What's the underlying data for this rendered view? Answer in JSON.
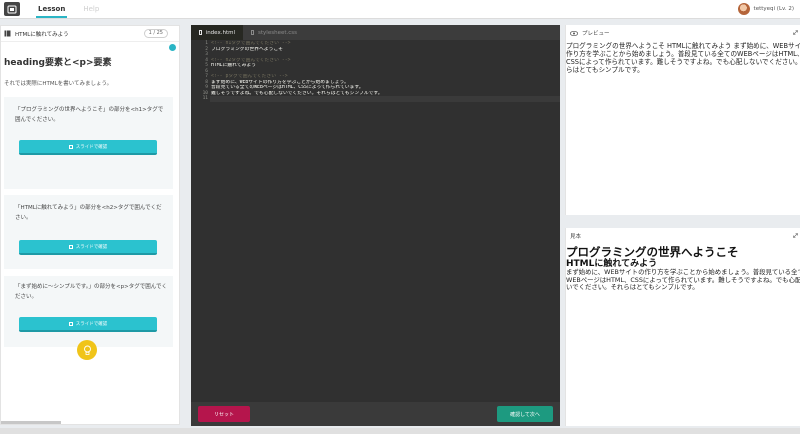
{
  "topbar": {
    "logo_icon": "app-logo-icon",
    "tabs": [
      {
        "label": "Lesson",
        "active": true
      },
      {
        "label": "Help",
        "active": false
      }
    ],
    "user": {
      "name": "tettyeqi (Lv. 2)",
      "avatar_icon": "user-avatar"
    }
  },
  "lesson": {
    "header_label": "HTMLに触れてみよう",
    "page_indicator": "1 / 25",
    "title": "heading要素と<p>要素",
    "intro": "それでは実際にHTMLを書いてみましょう。",
    "tasks": [
      {
        "text": "「プログラミングの世界へようこそ」の部分を<h1>タグで囲んでください。",
        "button": "スライドで確認"
      },
      {
        "text": "「HTMLに触れてみよう」の部分を<h2>タグで囲んでください。",
        "button": "スライドで確認"
      },
      {
        "text": "「まず始めに〜シンプルです。」の部分を<p>タグで囲んでください。",
        "button": "スライドで確認"
      }
    ],
    "hint_icon": "lightbulb-icon"
  },
  "editor": {
    "tabs": [
      {
        "label": "index.html",
        "active": true
      },
      {
        "label": "stylesheet.css",
        "active": false
      }
    ],
    "lines": [
      {
        "n": "1",
        "text": "<!-- h1タグで囲んでください -->",
        "comment": true
      },
      {
        "n": "2",
        "text": "プログラミングの世界へようこそ",
        "comment": false
      },
      {
        "n": "3",
        "text": "",
        "comment": false
      },
      {
        "n": "4",
        "text": "<!-- h2タグで囲んでください -->",
        "comment": true
      },
      {
        "n": "5",
        "text": "HTMLに触れてみよう",
        "comment": false
      },
      {
        "n": "6",
        "text": "",
        "comment": false
      },
      {
        "n": "7",
        "text": "<!-- pタグで囲んでください -->",
        "comment": true
      },
      {
        "n": "8",
        "text": "まず始めに、WEBサイトの作り方を学ぶことから始めましょう。",
        "comment": false
      },
      {
        "n": "9",
        "text": "普段見ている全てのWEBページはHTML、CSSによって作られています。",
        "comment": false
      },
      {
        "n": "10",
        "text": "難しそうですよね。でも心配しないでください。それらはとてもシンプルです。",
        "comment": false
      },
      {
        "n": "11",
        "text": "",
        "comment": false
      }
    ],
    "reset_label": "リセット",
    "next_label": "確認して次へ"
  },
  "preview": {
    "label": "プレビュー",
    "content": "プログラミングの世界へようこそ HTMLに触れてみよう まず始めに、WEBサイトの作り方を学ぶことから始めましょう。普段見ている全てのWEBページはHTML、CSSによって作られています。難しそうですよね。でも心配しないでください。それらはとてもシンプルです。"
  },
  "sample": {
    "label": "見本",
    "h1": "プログラミングの世界へようこそ",
    "h2": "HTMLに触れてみよう",
    "p": "まず始めに、WEBサイトの作り方を学ぶことから始めましょう。普段見ている全てのWEBページはHTML、CSSによって作られています。難しそうですよね。でも心配しないでください。それらはとてもシンプルです。"
  },
  "colors": {
    "accent": "#2bc2cf",
    "reset": "#b5154c",
    "next": "#1d9a80",
    "hint": "#f0c419",
    "editor_bg": "#303030"
  }
}
